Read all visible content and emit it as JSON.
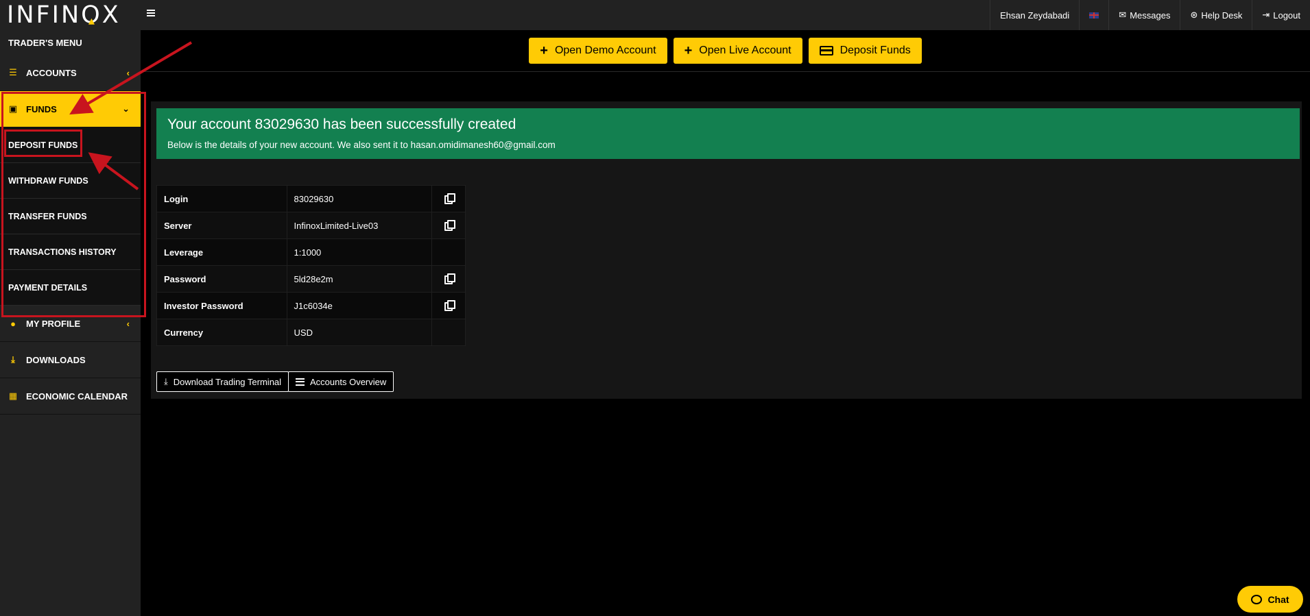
{
  "topbar": {
    "logo": "INFINOX",
    "user_name": "Ehsan Zeydabadi",
    "messages": "Messages",
    "help_desk": "Help Desk",
    "logout": "Logout"
  },
  "sidebar": {
    "title": "TRADER'S MENU",
    "items": [
      {
        "label": "ACCOUNTS",
        "icon": "list-icon"
      },
      {
        "label": "FUNDS",
        "icon": "wallet-icon"
      },
      {
        "label": "MY PROFILE",
        "icon": "user-icon"
      },
      {
        "label": "DOWNLOADS",
        "icon": "download-icon"
      },
      {
        "label": "ECONOMIC CALENDAR",
        "icon": "calendar-icon"
      }
    ],
    "funds_sub": [
      "DEPOSIT FUNDS",
      "WITHDRAW FUNDS",
      "TRANSFER FUNDS",
      "TRANSACTIONS HISTORY",
      "PAYMENT DETAILS"
    ]
  },
  "actions": {
    "open_demo": "Open Demo Account",
    "open_live": "Open Live Account",
    "deposit": "Deposit Funds"
  },
  "success": {
    "title": "Your account 83029630 has been successfully created",
    "subtitle": "Below is the details of your new account. We also sent it to hasan.omidimanesh60@gmail.com"
  },
  "details": [
    {
      "key": "Login",
      "value": "83029630",
      "copy": true
    },
    {
      "key": "Server",
      "value": "InfinoxLimited-Live03",
      "copy": true
    },
    {
      "key": "Leverage",
      "value": "1:1000",
      "copy": false
    },
    {
      "key": "Password",
      "value": "5ld28e2m",
      "copy": true
    },
    {
      "key": "Investor Password",
      "value": "J1c6034e",
      "copy": true
    },
    {
      "key": "Currency",
      "value": "USD",
      "copy": false
    }
  ],
  "buttons": {
    "download_terminal": "Download Trading Terminal",
    "accounts_overview": "Accounts Overview"
  },
  "chat": {
    "label": "Chat"
  },
  "colors": {
    "accent": "#ffcb05",
    "success": "#138050",
    "annotation": "#c8141e"
  }
}
